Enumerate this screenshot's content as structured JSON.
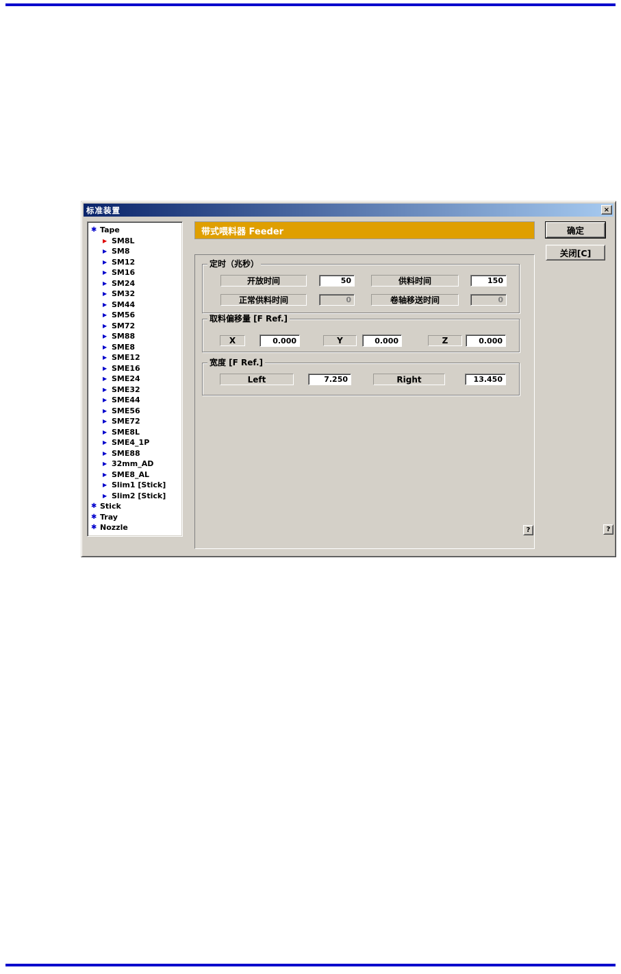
{
  "page": {
    "background": "#FFFFFF",
    "rule_color": "#0A0ACC"
  },
  "dialog": {
    "title": "标准装置",
    "close_glyph": "×",
    "colors": {
      "face": "#D4D0C8",
      "titlebar_start": "#0A246A",
      "titlebar_end": "#A6CAF0",
      "header_bg": "#DF9F00",
      "tree_icon_blue": "#0000CC",
      "tree_icon_red": "#DD0000",
      "disabled_text": "#808080"
    },
    "tree": {
      "items": [
        {
          "label": "Tape",
          "level": 0,
          "icon": "branch",
          "color": "blue"
        },
        {
          "label": "SM8L",
          "level": 1,
          "icon": "leaf",
          "color": "red"
        },
        {
          "label": "SM8",
          "level": 1,
          "icon": "leaf",
          "color": "blue"
        },
        {
          "label": "SM12",
          "level": 1,
          "icon": "leaf",
          "color": "blue"
        },
        {
          "label": "SM16",
          "level": 1,
          "icon": "leaf",
          "color": "blue"
        },
        {
          "label": "SM24",
          "level": 1,
          "icon": "leaf",
          "color": "blue"
        },
        {
          "label": "SM32",
          "level": 1,
          "icon": "leaf",
          "color": "blue"
        },
        {
          "label": "SM44",
          "level": 1,
          "icon": "leaf",
          "color": "blue"
        },
        {
          "label": "SM56",
          "level": 1,
          "icon": "leaf",
          "color": "blue"
        },
        {
          "label": "SM72",
          "level": 1,
          "icon": "leaf",
          "color": "blue"
        },
        {
          "label": "SM88",
          "level": 1,
          "icon": "leaf",
          "color": "blue"
        },
        {
          "label": "SME8",
          "level": 1,
          "icon": "leaf",
          "color": "blue"
        },
        {
          "label": "SME12",
          "level": 1,
          "icon": "leaf",
          "color": "blue"
        },
        {
          "label": "SME16",
          "level": 1,
          "icon": "leaf",
          "color": "blue"
        },
        {
          "label": "SME24",
          "level": 1,
          "icon": "leaf",
          "color": "blue"
        },
        {
          "label": "SME32",
          "level": 1,
          "icon": "leaf",
          "color": "blue"
        },
        {
          "label": "SME44",
          "level": 1,
          "icon": "leaf",
          "color": "blue"
        },
        {
          "label": "SME56",
          "level": 1,
          "icon": "leaf",
          "color": "blue"
        },
        {
          "label": "SME72",
          "level": 1,
          "icon": "leaf",
          "color": "blue"
        },
        {
          "label": "SME8L",
          "level": 1,
          "icon": "leaf",
          "color": "blue"
        },
        {
          "label": "SME4_1P",
          "level": 1,
          "icon": "leaf",
          "color": "blue"
        },
        {
          "label": "SME88",
          "level": 1,
          "icon": "leaf",
          "color": "blue"
        },
        {
          "label": "32mm_AD",
          "level": 1,
          "icon": "leaf",
          "color": "blue"
        },
        {
          "label": "SME8_AL",
          "level": 1,
          "icon": "leaf",
          "color": "blue"
        },
        {
          "label": "Slim1 [Stick]",
          "level": 1,
          "icon": "leaf",
          "color": "blue"
        },
        {
          "label": "Slim2 [Stick]",
          "level": 1,
          "icon": "leaf",
          "color": "blue"
        },
        {
          "label": "Stick",
          "level": 0,
          "icon": "branch",
          "color": "blue"
        },
        {
          "label": "Tray",
          "level": 0,
          "icon": "branch",
          "color": "blue"
        },
        {
          "label": "Nozzle",
          "level": 0,
          "icon": "branch",
          "color": "blue"
        }
      ]
    },
    "header": {
      "title": "带式喂料器 Feeder"
    },
    "groups": {
      "timing": {
        "title": "定时（兆秒）",
        "fields": [
          {
            "label": "开放时间",
            "value": "50",
            "enabled": true
          },
          {
            "label": "供料时间",
            "value": "150",
            "enabled": true
          },
          {
            "label": "正常供料时间",
            "value": "0",
            "enabled": false
          },
          {
            "label": "卷轴移送时间",
            "value": "0",
            "enabled": false
          }
        ]
      },
      "pick_offset": {
        "title": "取料偏移量 [F Ref.]",
        "fields": [
          {
            "label": "X",
            "value": "0.000"
          },
          {
            "label": "Y",
            "value": "0.000"
          },
          {
            "label": "Z",
            "value": "0.000"
          }
        ]
      },
      "width": {
        "title": "宽度 [F Ref.]",
        "fields": [
          {
            "label": "Left",
            "value": "7.250"
          },
          {
            "label": "Right",
            "value": "13.450"
          }
        ]
      }
    },
    "buttons": {
      "ok": "确定",
      "close": "关闭[C]",
      "help": "?"
    }
  }
}
